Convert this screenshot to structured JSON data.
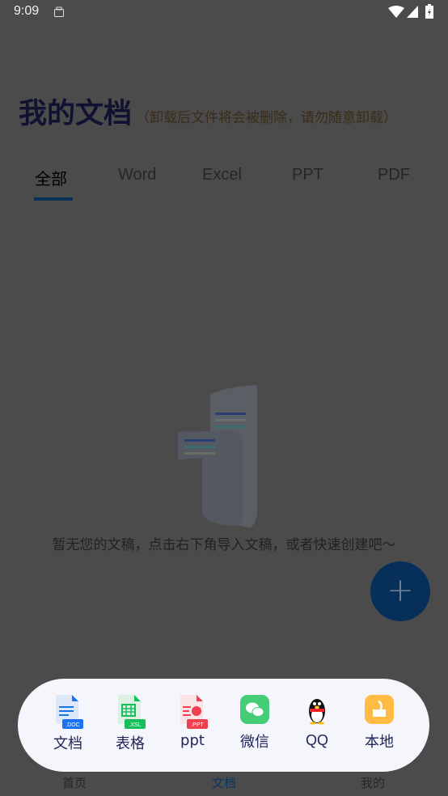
{
  "status_bar": {
    "time": "9:09"
  },
  "header": {
    "title": "我的文档",
    "subtitle": "（卸载后文件将会被删除，请勿随意卸载）"
  },
  "tabs": [
    {
      "label": "全部",
      "active": true
    },
    {
      "label": "Word"
    },
    {
      "label": "Excel"
    },
    {
      "label": "PPT"
    },
    {
      "label": "PDF"
    }
  ],
  "empty_state": {
    "message": "暂无您的文稿，点击右下角导入文稿，或者快速创建吧～"
  },
  "fab": {
    "label": "+"
  },
  "import_sheet": {
    "items": [
      {
        "label": "文档",
        "badge": ".DOC",
        "color": "#1a73f0",
        "icon": "doc-file-icon"
      },
      {
        "label": "表格",
        "badge": ".XSL",
        "color": "#15c05a",
        "icon": "xls-file-icon"
      },
      {
        "label": "ppt",
        "badge": ".PPT",
        "color": "#f04050",
        "icon": "ppt-file-icon"
      },
      {
        "label": "微信",
        "color": "#44cc77",
        "icon": "wechat-icon"
      },
      {
        "label": "QQ",
        "icon": "qq-icon"
      },
      {
        "label": "本地",
        "color": "#ffbb44",
        "icon": "local-folder-icon"
      }
    ]
  },
  "bottom_nav": [
    {
      "label": "首页"
    },
    {
      "label": "文档",
      "active": true,
      "color": "#0b3560"
    },
    {
      "label": "我的"
    }
  ]
}
